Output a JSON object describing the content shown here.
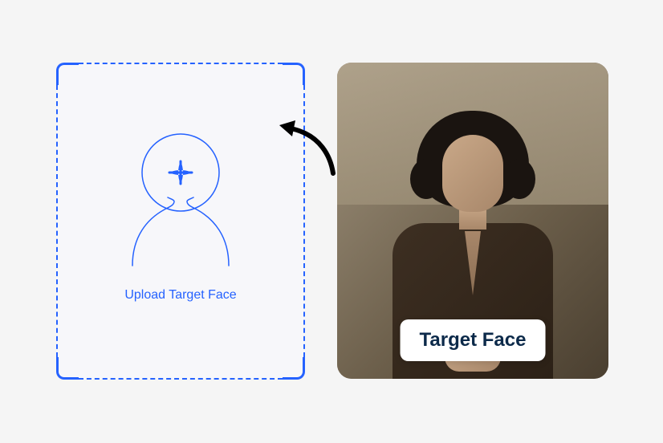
{
  "upload_zone": {
    "label": "Upload Target Face"
  },
  "photo_card": {
    "badge_label": "Target Face"
  },
  "colors": {
    "accent": "#2562ff",
    "badge_text": "#0c2a4a"
  }
}
